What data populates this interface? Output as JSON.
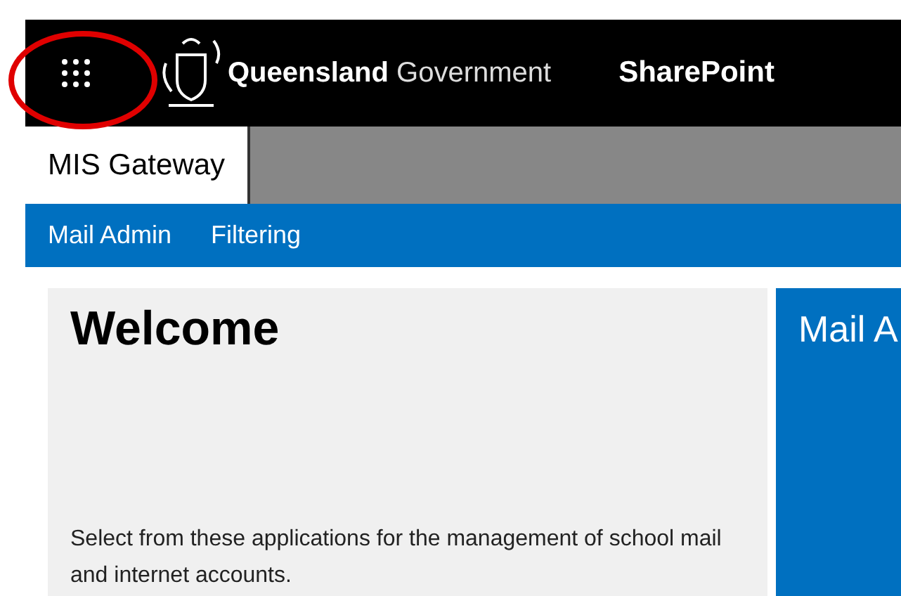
{
  "header": {
    "brand_bold": "Queensland",
    "brand_light": "Government",
    "app": "SharePoint"
  },
  "tabs": [
    {
      "label": "MIS Gateway",
      "selected": true
    }
  ],
  "nav": [
    "Mail Admin",
    "Filtering"
  ],
  "welcome": {
    "title": "Welcome",
    "text": "Select from these applications for the management of school mail and internet accounts."
  },
  "tile": {
    "title": "Mail A"
  }
}
